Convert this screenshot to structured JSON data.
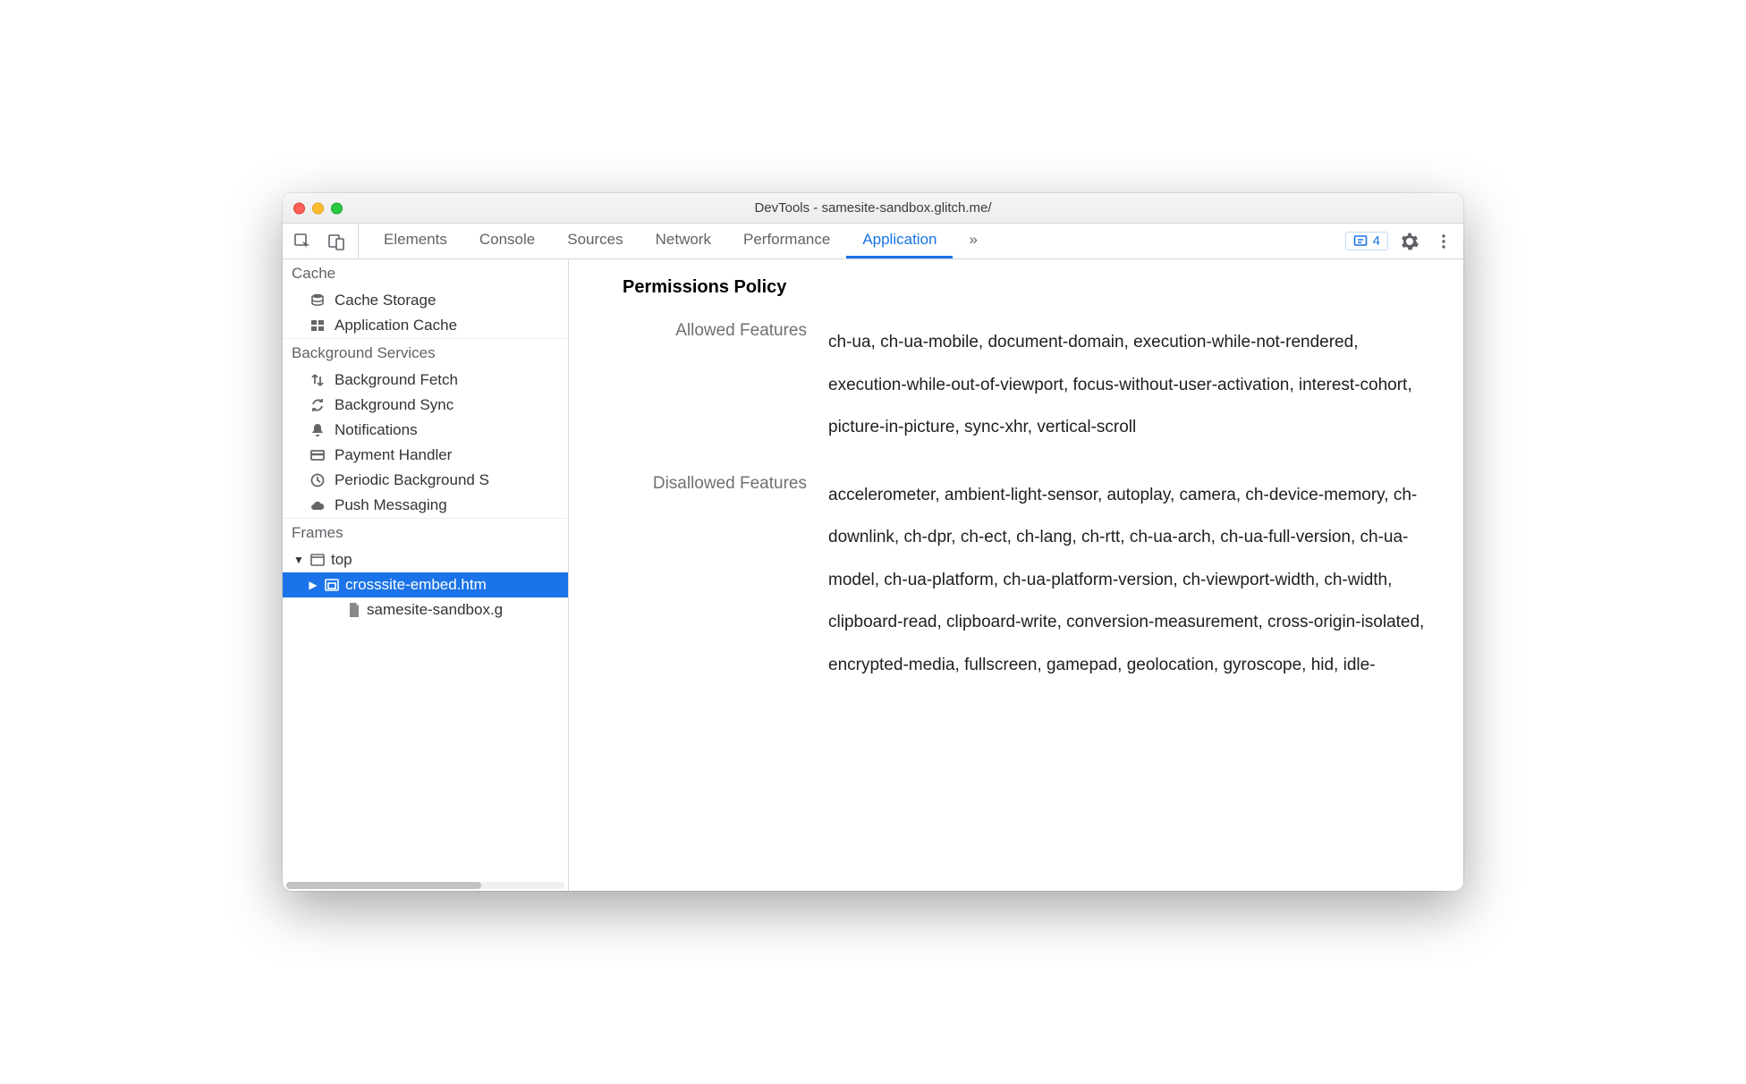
{
  "window": {
    "title": "DevTools - samesite-sandbox.glitch.me/"
  },
  "tabs": {
    "items": [
      "Elements",
      "Console",
      "Sources",
      "Network",
      "Performance",
      "Application"
    ],
    "active_index": 5,
    "overflow_glyph": "»"
  },
  "toolbar": {
    "issue_count": "4"
  },
  "sidebar": {
    "groups": [
      {
        "title": "Cache",
        "items": [
          {
            "icon": "db-stack-icon",
            "label": "Cache Storage"
          },
          {
            "icon": "grid-icon",
            "label": "Application Cache"
          }
        ]
      },
      {
        "title": "Background Services",
        "items": [
          {
            "icon": "transfer-icon",
            "label": "Background Fetch"
          },
          {
            "icon": "sync-icon",
            "label": "Background Sync"
          },
          {
            "icon": "bell-icon",
            "label": "Notifications"
          },
          {
            "icon": "card-icon",
            "label": "Payment Handler"
          },
          {
            "icon": "clock-icon",
            "label": "Periodic Background S"
          },
          {
            "icon": "cloud-icon",
            "label": "Push Messaging"
          }
        ]
      }
    ],
    "frames": {
      "title": "Frames",
      "tree": [
        {
          "depth": 0,
          "expand": "▼",
          "icon": "window-icon",
          "label": "top",
          "selected": false
        },
        {
          "depth": 1,
          "expand": "▶",
          "icon": "iframe-icon",
          "label": "crosssite-embed.htm",
          "selected": true
        },
        {
          "depth": 1,
          "expand": "",
          "icon": "file-icon",
          "label": "samesite-sandbox.g",
          "selected": false
        }
      ]
    }
  },
  "main": {
    "heading": "Permissions Policy",
    "rows": [
      {
        "label": "Allowed Features",
        "value": "ch-ua, ch-ua-mobile, document-domain, execution-while-not-rendered, execution-while-out-of-viewport, focus-without-user-activation, interest-cohort, picture-in-picture, sync-xhr, vertical-scroll"
      },
      {
        "label": "Disallowed Features",
        "value": "accelerometer, ambient-light-sensor, autoplay, camera, ch-device-memory, ch-downlink, ch-dpr, ch-ect, ch-lang, ch-rtt, ch-ua-arch, ch-ua-full-version, ch-ua-model, ch-ua-platform, ch-ua-platform-version, ch-viewport-width, ch-width, clipboard-read, clipboard-write, conversion-measurement, cross-origin-isolated, encrypted-media, fullscreen, gamepad, geolocation, gyroscope, hid, idle-"
      }
    ]
  }
}
